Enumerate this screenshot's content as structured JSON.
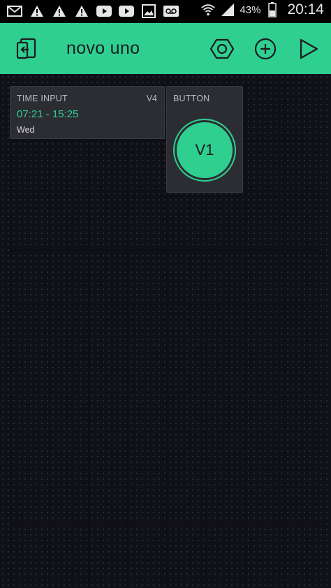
{
  "status_bar": {
    "icons_left": [
      "mail-icon",
      "warning-icon",
      "warning-icon",
      "warning-icon",
      "youtube-icon",
      "youtube-icon",
      "gallery-icon",
      "voicemail-icon"
    ],
    "icons_right": [
      "wifi-icon",
      "signal-icon"
    ],
    "battery_percent": "43%",
    "time": "20:14"
  },
  "app_bar": {
    "title": "novo uno",
    "exit_icon": "exit-icon",
    "settings_icon": "hex-nut-icon",
    "add_icon": "add-circle-icon",
    "play_icon": "play-icon",
    "background_color": "#2fcf90"
  },
  "widgets": {
    "time_input": {
      "label": "TIME INPUT",
      "pin": "V4",
      "time_range": "07:21 - 15:25",
      "day": "Wed"
    },
    "button": {
      "label": "BUTTON",
      "pin": "V1"
    }
  },
  "colors": {
    "accent": "#2fcf90",
    "canvas": "#17181f",
    "widget_bg": "#2c2d33"
  }
}
